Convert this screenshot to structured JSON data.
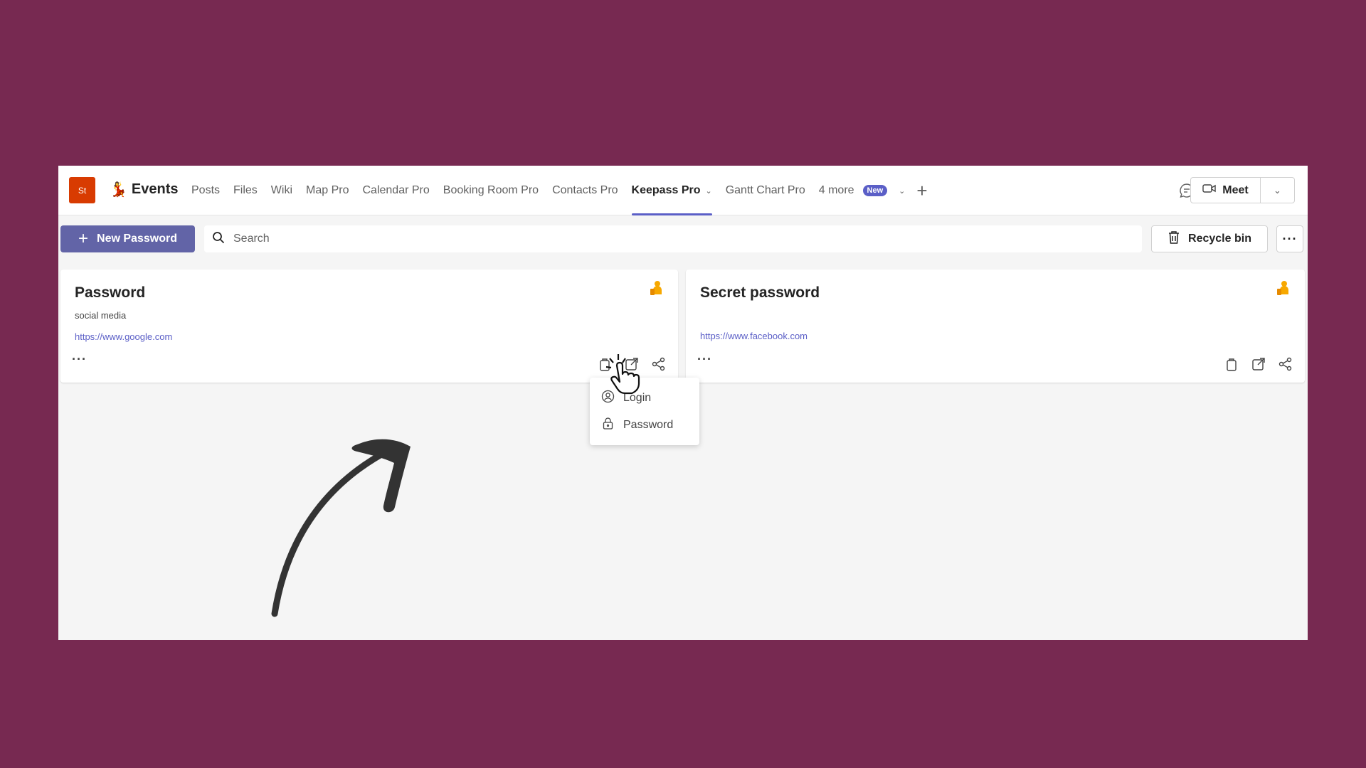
{
  "header": {
    "team_initials": "St",
    "channel_emoji": "💃",
    "channel_name": "Events",
    "tabs": [
      {
        "label": "Posts"
      },
      {
        "label": "Files"
      },
      {
        "label": "Wiki"
      },
      {
        "label": "Map Pro"
      },
      {
        "label": "Calendar Pro"
      },
      {
        "label": "Booking Room Pro"
      },
      {
        "label": "Contacts Pro"
      },
      {
        "label": "Keepass Pro",
        "active": true
      },
      {
        "label": "Gantt Chart Pro"
      },
      {
        "label": "4 more"
      }
    ],
    "new_badge": "New",
    "meet_label": "Meet"
  },
  "toolbar": {
    "new_password_label": "New Password",
    "search_placeholder": "Search",
    "recycle_bin_label": "Recycle bin"
  },
  "cards": [
    {
      "title": "Password",
      "description": "social media",
      "url": "https://www.google.com"
    },
    {
      "title": "Secret password",
      "description": "",
      "url": "https://www.facebook.com"
    }
  ],
  "dropdown": {
    "items": [
      {
        "label": "Login",
        "icon": "user-circle-icon"
      },
      {
        "label": "Password",
        "icon": "lock-icon"
      }
    ]
  },
  "colors": {
    "background": "#772951",
    "accent": "#5b5fc7",
    "primary_button": "#6264a7",
    "team_avatar": "#d83b01",
    "key_icon": "#f7a800"
  }
}
